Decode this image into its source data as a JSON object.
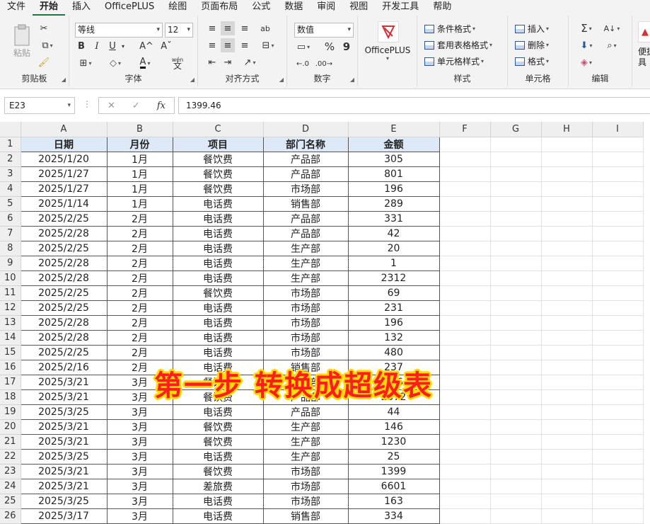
{
  "tabs": [
    "文件",
    "开始",
    "插入",
    "OfficePLUS",
    "绘图",
    "页面布局",
    "公式",
    "数据",
    "审阅",
    "视图",
    "开发工具",
    "帮助"
  ],
  "ribbon": {
    "clipboard": {
      "label": "剪贴板",
      "paste": "粘贴"
    },
    "font": {
      "label": "字体",
      "name": "等线",
      "size": "12",
      "bold": "B",
      "italic": "I",
      "underline": "U",
      "grow": "A^",
      "shrink": "Aˇ",
      "wen": "wén",
      "wen_char": "文"
    },
    "alignment": {
      "label": "对齐方式",
      "wrap": "ab"
    },
    "number": {
      "label": "数字",
      "format": "数值",
      "percent": "%",
      "comma": "9"
    },
    "officeplus": {
      "label": "OfficePLUS"
    },
    "styles": {
      "label": "样式",
      "items": [
        "条件格式",
        "套用表格格式",
        "单元格样式"
      ]
    },
    "cells": {
      "label": "单元格",
      "items": [
        "插入",
        "删除",
        "格式"
      ]
    },
    "editing": {
      "label": "编辑"
    },
    "extra": {
      "label": "便捷",
      "label2": "具"
    }
  },
  "formula_bar": {
    "name_box": "E23",
    "value": "1399.46",
    "cancel": "✕",
    "enter": "✓",
    "fx": "fx"
  },
  "sheet": {
    "columns": [
      "A",
      "B",
      "C",
      "D",
      "E",
      "F",
      "G",
      "H",
      "I"
    ],
    "headers": [
      "日期",
      "月份",
      "项目",
      "部门名称",
      "金额"
    ],
    "rows": [
      [
        "2025/1/20",
        "1月",
        "餐饮费",
        "产品部",
        "305"
      ],
      [
        "2025/1/27",
        "1月",
        "餐饮费",
        "产品部",
        "801"
      ],
      [
        "2025/1/27",
        "1月",
        "餐饮费",
        "市场部",
        "196"
      ],
      [
        "2025/1/14",
        "1月",
        "电话费",
        "销售部",
        "289"
      ],
      [
        "2025/2/25",
        "2月",
        "电话费",
        "产品部",
        "331"
      ],
      [
        "2025/2/28",
        "2月",
        "电话费",
        "产品部",
        "42"
      ],
      [
        "2025/2/25",
        "2月",
        "电话费",
        "生产部",
        "20"
      ],
      [
        "2025/2/28",
        "2月",
        "电话费",
        "生产部",
        "1"
      ],
      [
        "2025/2/28",
        "2月",
        "电话费",
        "生产部",
        "2312"
      ],
      [
        "2025/2/25",
        "2月",
        "餐饮费",
        "市场部",
        "69"
      ],
      [
        "2025/2/25",
        "2月",
        "电话费",
        "市场部",
        "231"
      ],
      [
        "2025/2/28",
        "2月",
        "电话费",
        "市场部",
        "196"
      ],
      [
        "2025/2/28",
        "2月",
        "电话费",
        "市场部",
        "132"
      ],
      [
        "2025/2/25",
        "2月",
        "电话费",
        "市场部",
        "480"
      ],
      [
        "2025/2/16",
        "2月",
        "电话费",
        "销售部",
        "237"
      ],
      [
        "2025/3/21",
        "3月",
        "餐饮费",
        "产品部",
        "186"
      ],
      [
        "2025/3/21",
        "3月",
        "餐饮费",
        "产品部",
        "2072"
      ],
      [
        "2025/3/25",
        "3月",
        "电话费",
        "产品部",
        "44"
      ],
      [
        "2025/3/21",
        "3月",
        "餐饮费",
        "生产部",
        "146"
      ],
      [
        "2025/3/21",
        "3月",
        "餐饮费",
        "生产部",
        "1230"
      ],
      [
        "2025/3/25",
        "3月",
        "电话费",
        "生产部",
        "25"
      ],
      [
        "2025/3/21",
        "3月",
        "餐饮费",
        "市场部",
        "1399"
      ],
      [
        "2025/3/21",
        "3月",
        "差旅费",
        "市场部",
        "6601"
      ],
      [
        "2025/3/25",
        "3月",
        "电话费",
        "市场部",
        "163"
      ],
      [
        "2025/3/17",
        "3月",
        "电话费",
        "销售部",
        "334"
      ]
    ]
  },
  "overlay_text": "第一步  转换成超级表",
  "colors": {
    "accent": "#217346",
    "header_fill": "#dde9f6",
    "overlay_text": "#ff1e1e",
    "overlay_outline": "#ffd900"
  }
}
